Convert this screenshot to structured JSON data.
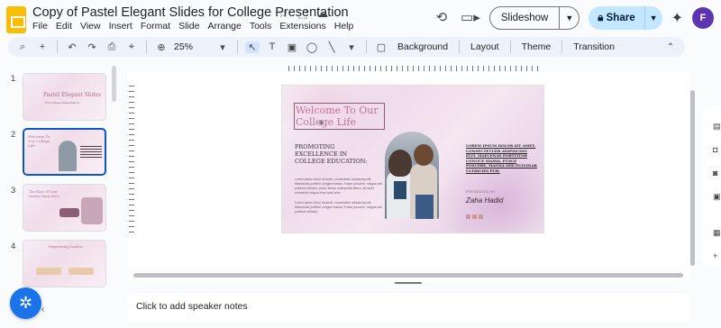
{
  "document": {
    "title": "Copy of Pastel Elegant Slides for College Presentation"
  },
  "menu": [
    "File",
    "Edit",
    "View",
    "Insert",
    "Format",
    "Slide",
    "Arrange",
    "Tools",
    "Extensions",
    "Help"
  ],
  "header": {
    "slideshow_label": "Slideshow",
    "share_label": "Share",
    "avatar_letter": "F"
  },
  "toolbar": {
    "zoom": "25%",
    "background_label": "Background",
    "layout_label": "Layout",
    "theme_label": "Theme",
    "transition_label": "Transition"
  },
  "filmstrip": {
    "slides": [
      {
        "number": "1",
        "title": "Pastel Elegant Slides",
        "subtitle": "For College Presentation"
      },
      {
        "number": "2",
        "title": "Welcome To Our College Life"
      },
      {
        "number": "3",
        "title": "The Place Of Your Dream Starts Here"
      },
      {
        "number": "4",
        "title": "Empowering Leaders"
      }
    ]
  },
  "slide": {
    "title_line1": "Welcome To Our",
    "title_line2": "College Life",
    "heading_line1": "PROMOTING",
    "heading_line2": "EXCELLENCE IN",
    "heading_line3": "COLLEGE EDUCATION:",
    "body1": "Lorem ipsum dolor sit amet, consectetur adipiscing elit. Maecenas porttitor congue massa. Fusce posuere, magna sed pulvinar ultricies, purus lectus malesuada libero, sit amet commodo magna eros quis urna.",
    "body2": "Lorem ipsum dolor sit amet, consectetur adipiscing elit. Maecenas porttitor congue massa. Fusce posuere, magna sed pulvinar ultricies.",
    "right_heading": "LOREM IPSUM DOLOR SIT AMET, CONSECTETUER ADIPISCING ELIT. MAECENAS PORTTITOR CONGUE MASSA. FUSCE POSUERE, MAGNA SED PULVINAR ULTRICIES PUR.",
    "presented_by": "PRESENTED BY",
    "presenter": "Zaha Hadid"
  },
  "notes": {
    "placeholder": "Click to add speaker notes"
  },
  "icons": {
    "star": "star-icon",
    "move": "move-to-folder-icon",
    "cloud": "cloud-saved-icon",
    "history": "history-icon",
    "meet": "video-camera-icon",
    "gemini": "gemini-sparkle-icon"
  },
  "colors": {
    "accent": "#0b57d0",
    "share_bg": "#c2e7ff",
    "slide_title": "#c0729b",
    "logo": "#fbbc04"
  }
}
